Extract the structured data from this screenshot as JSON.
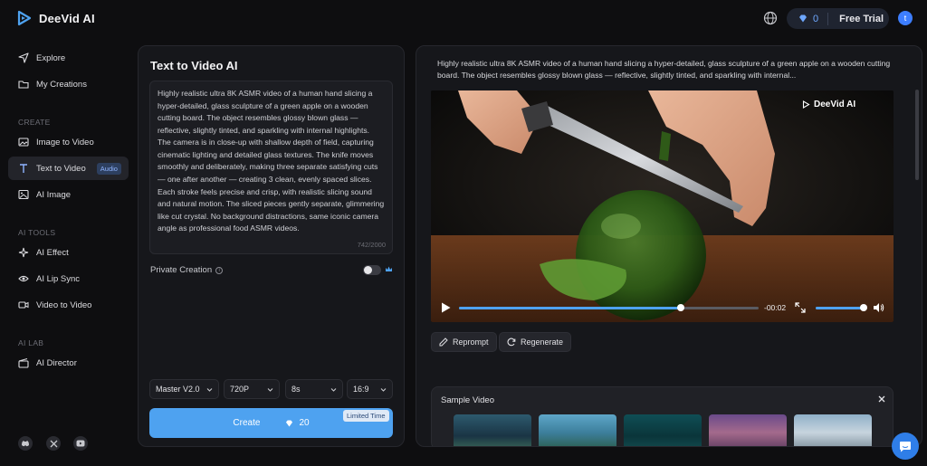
{
  "app": {
    "name": "DeeVid AI"
  },
  "header": {
    "credits": "0",
    "trial_label": "Free Trial",
    "avatar_letter": "t"
  },
  "sidebar": {
    "items_top": [
      {
        "label": "Explore",
        "icon": "explore-icon"
      },
      {
        "label": "My Creations",
        "icon": "folder-icon"
      }
    ],
    "create_title": "CREATE",
    "create_items": [
      {
        "label": "Image to Video",
        "icon": "image-icon"
      },
      {
        "label": "Text to Video",
        "icon": "text-icon",
        "badge": "Audio",
        "active": true
      },
      {
        "label": "AI Image",
        "icon": "picture-icon"
      }
    ],
    "tools_title": "AI TOOLS",
    "tools_items": [
      {
        "label": "AI Effect",
        "icon": "sparkle-icon"
      },
      {
        "label": "AI Lip Sync",
        "icon": "eye-icon"
      },
      {
        "label": "Video to Video",
        "icon": "video-icon"
      }
    ],
    "lab_title": "AI LAB",
    "lab_items": [
      {
        "label": "AI Director",
        "icon": "director-icon"
      }
    ]
  },
  "editor": {
    "title": "Text to Video AI",
    "prompt": "Highly realistic ultra 8K ASMR video of a human hand slicing a hyper-detailed, glass sculpture of a green apple on a wooden cutting board. The object resembles glossy blown glass — reflective, slightly tinted, and sparkling with internal highlights. The camera is in close-up with shallow depth of field, capturing cinematic lighting and detailed glass textures. The knife moves smoothly and deliberately, making three separate satisfying cuts — one after another — creating 3 clean, evenly spaced slices. Each stroke feels precise and crisp, with realistic slicing sound and natural motion. The sliced pieces gently separate, glimmering like cut crystal. No background distractions, same iconic camera angle as professional food ASMR videos.",
    "char_count": "742/2000",
    "private_label": "Private Creation",
    "private_on": false,
    "model": "Master V2.0",
    "resolution": "720P",
    "duration": "8s",
    "ratio": "16:9",
    "create_label": "Create",
    "create_cost": "20",
    "limited_label": "Limited Time"
  },
  "preview": {
    "description": "Highly realistic ultra 8K ASMR video of a human hand slicing a hyper-detailed, glass sculpture of a green apple on a wooden cutting board. The object resembles glossy blown glass — reflective, slightly tinted, and sparkling with internal...",
    "watermark": "DeeVid AI",
    "time_left": "-00:02",
    "progress": 0.74,
    "volume": 0.95,
    "reprompt_label": "Reprompt",
    "regenerate_label": "Regenerate",
    "sample_title": "Sample Video"
  },
  "colors": {
    "accent": "#4ea2f0",
    "background": "#0e0e10",
    "panel": "#16171b"
  }
}
